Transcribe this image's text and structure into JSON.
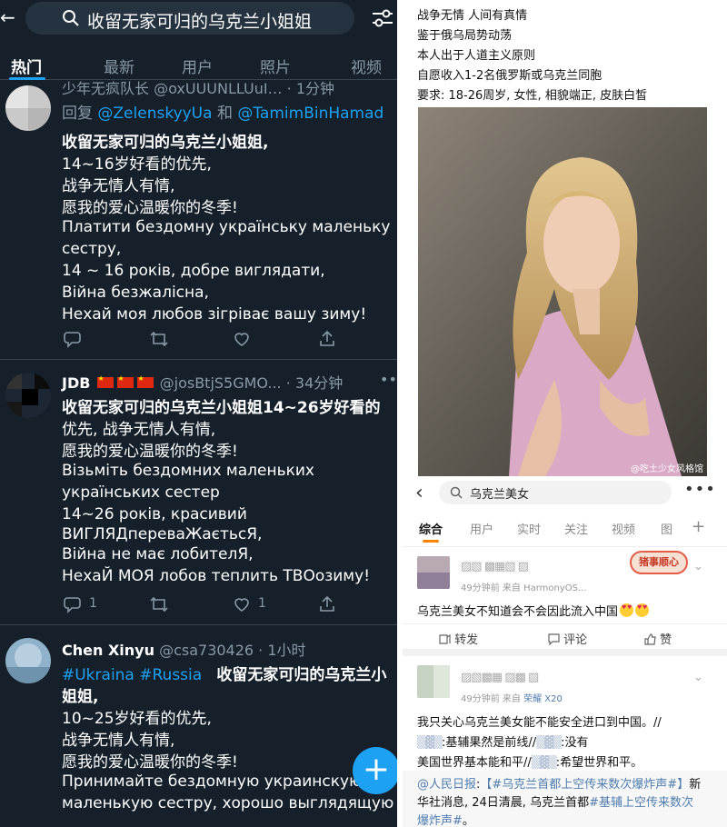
{
  "left": {
    "search_query": "收留无家可归的乌克兰小姐姐",
    "tabs": [
      "热门",
      "最新",
      "用户",
      "照片",
      "视频"
    ],
    "tweets": [
      {
        "header": "少年无疯队长 @oxUUUNLLUuI… · 1分钟",
        "reply_prefix": "回复 ",
        "reply_to_1": "@ZelenskyyUa",
        "reply_and": " 和 ",
        "reply_to_2": "@TamimBinHamad",
        "lines": [
          "收留无家可归的乌克兰小姐姐,",
          "14~16岁好看的优先,",
          "战争无情人有情,",
          "愿我的爱心温暖你的冬季!",
          "Платити бездомну українську маленьку",
          "сестру,",
          "14 ~ 16 років, добре виглядати,",
          "Війна безжалісна,",
          "Нехай моя любов зігріває вашу зиму!"
        ]
      },
      {
        "name": "JDB",
        "handle": "@josBtjS5GMO... · 34分钟",
        "lines": [
          "收留无家可归的乌克兰小姐姐14~26岁好看的",
          "优先, 战争无情人有情,",
          "愿我的爱心温暖你的冬季!",
          "Візьміть бездомних маленьких",
          "українських сестер",
          "14~26 років, красивий",
          "ВИГЛЯДпереваЖаєтьсЯ,",
          "Війна не має лобителЯ,",
          "НехаЙ МОЯ лобов теплить ТВОозиму!"
        ],
        "reply_count": "1",
        "like_count": "1"
      },
      {
        "name": "Chen Xinyu",
        "handle": "@csa730426 · 1小时",
        "hashtags": "#Ukraina #Russia",
        "first_line_rest": "收留无家可归的乌克兰小",
        "lines": [
          "姐姐,",
          "10~25岁好看的优先,",
          "战争无情人有情,",
          "愿我的爱心温暖你的冬季!",
          "Принимайте бездомную украинскую",
          "маленькую сестру, хорошо выглядящую и"
        ]
      }
    ],
    "fab_label": "+"
  },
  "right": {
    "post_lines": [
      "战争无情 人间有真情",
      "鉴于俄乌局势动荡",
      "本人出于人道主义原则",
      "自愿收入1-2名俄罗斯或乌克兰同胞",
      "要求: 18-26周岁, 女性, 相貌端正, 皮肤白皙"
    ],
    "photo_watermark": "@吃土少女风格馆",
    "search_query": "乌克兰美女",
    "more_label": "•••",
    "tabs": [
      "综合",
      "用户",
      "实时",
      "关注",
      "视频",
      "图"
    ],
    "plus_label": "+",
    "sticker_text": "猪事顺心",
    "card1": {
      "name_blur": "▨▧ ▩▦▧ ▨",
      "meta": "49分钟前  来自 HarmonyOS...",
      "text": "乌克兰美女不知道会不会因此流入中国",
      "repost_label": "转发",
      "comment_label": "评论",
      "like_label": "赞"
    },
    "card2": {
      "name_blur": "▨▧▩▦ ▨▩ ▧",
      "meta_prefix": "49分钟前  来自",
      "meta_device": "荣耀 X20",
      "line1": "我只关心乌克兰美女能不能安全进口到中国。//",
      "line2_blur": "▒▓▒",
      "line2": ":基辅果然是前线//",
      "line2_tail": ":没有",
      "line3": "美国世界基本能和平//",
      "line3_tail": ":希望世界和平。",
      "repost_user": "@人民日报",
      "repost_tag": "【#乌克兰首都上空传来数次爆炸声#】",
      "repost_text1": "新",
      "repost_text2": "华社消息, 24日清晨, 乌克兰首都",
      "repost_tag2": "#基辅上空传来数次",
      "repost_tag3": "爆炸声#",
      "repost_end": "。"
    }
  },
  "colors": {
    "twitter_bg": "#15202b",
    "twitter_blue": "#1da1f2",
    "weibo_orange": "#ff8200",
    "weibo_link": "#507daf"
  }
}
